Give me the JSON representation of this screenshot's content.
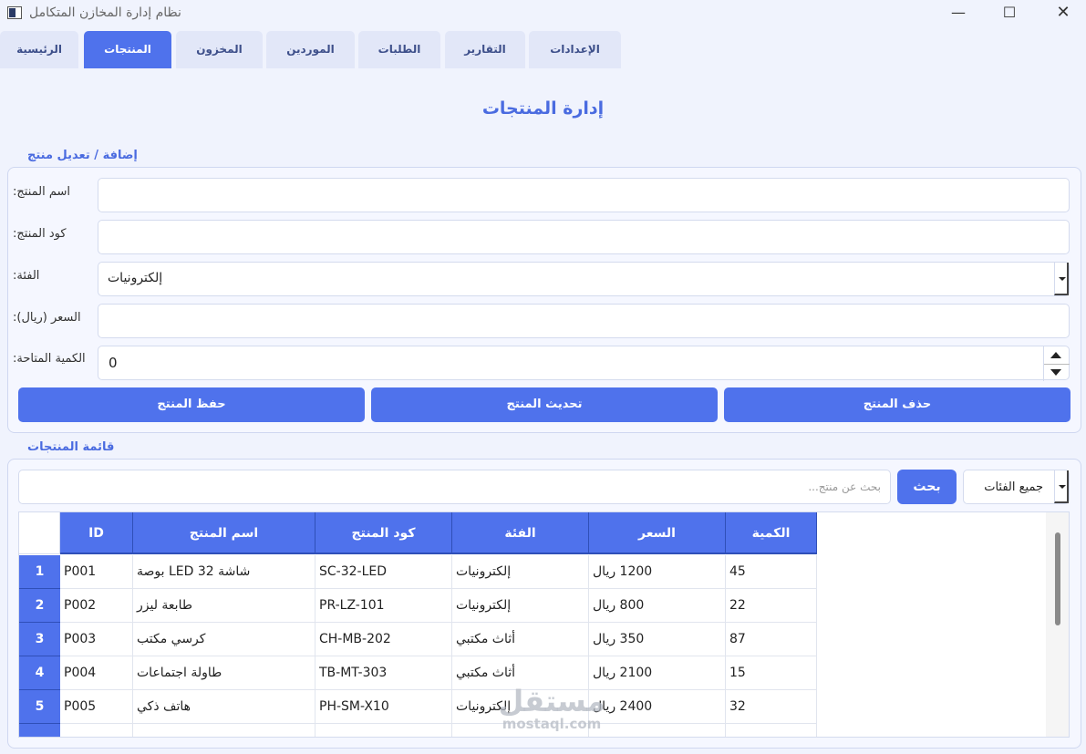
{
  "window": {
    "title": "نظام إدارة المخازن المتكامل",
    "minimize": "—",
    "maximize": "☐",
    "close": "✕"
  },
  "tabs": [
    {
      "label": "الرئيسية"
    },
    {
      "label": "المنتجات"
    },
    {
      "label": "المخزون"
    },
    {
      "label": "الموردين"
    },
    {
      "label": "الطلبات"
    },
    {
      "label": "التقارير"
    },
    {
      "label": "الإعدادات"
    }
  ],
  "page_title": "إدارة المنتجات",
  "form": {
    "group_title": "إضافة / تعديل منتج",
    "name_label": "اسم المنتج:",
    "name_value": "",
    "code_label": "كود المنتج:",
    "code_value": "",
    "category_label": "الفئة:",
    "category_value": "إلكترونيات",
    "price_label": "السعر (ريال):",
    "price_value": "",
    "quantity_label": "الكمية المتاحة:",
    "quantity_value": "0",
    "save_button": "حفظ المنتج",
    "update_button": "تحديث المنتج",
    "delete_button": "حذف المنتج"
  },
  "list": {
    "group_title": "قائمة المنتجات",
    "search_placeholder": "بحث عن منتج...",
    "search_button": "بحث",
    "filter_value": "جميع الفئات",
    "columns": [
      "ID",
      "اسم المنتج",
      "كود المنتج",
      "الفئة",
      "السعر",
      "الكمية"
    ],
    "rows": [
      {
        "num": "1",
        "id": "P001",
        "name": "شاشة LED 32 بوصة",
        "code": "SC-32-LED",
        "category": "إلكترونيات",
        "price": "1200 ريال",
        "qty": "45"
      },
      {
        "num": "2",
        "id": "P002",
        "name": "طابعة ليزر",
        "code": "PR-LZ-101",
        "category": "إلكترونيات",
        "price": "800 ريال",
        "qty": "22"
      },
      {
        "num": "3",
        "id": "P003",
        "name": "كرسي مكتب",
        "code": "CH-MB-202",
        "category": "أثاث مكتبي",
        "price": "350 ريال",
        "qty": "87"
      },
      {
        "num": "4",
        "id": "P004",
        "name": "طاولة اجتماعات",
        "code": "TB-MT-303",
        "category": "أثاث مكتبي",
        "price": "2100 ريال",
        "qty": "15"
      },
      {
        "num": "5",
        "id": "P005",
        "name": "هاتف ذكي",
        "code": "PH-SM-X10",
        "category": "إلكترونيات",
        "price": "2400 ريال",
        "qty": "32"
      }
    ]
  },
  "watermark": {
    "main": "مستقل",
    "sub": "mostaql.com"
  }
}
